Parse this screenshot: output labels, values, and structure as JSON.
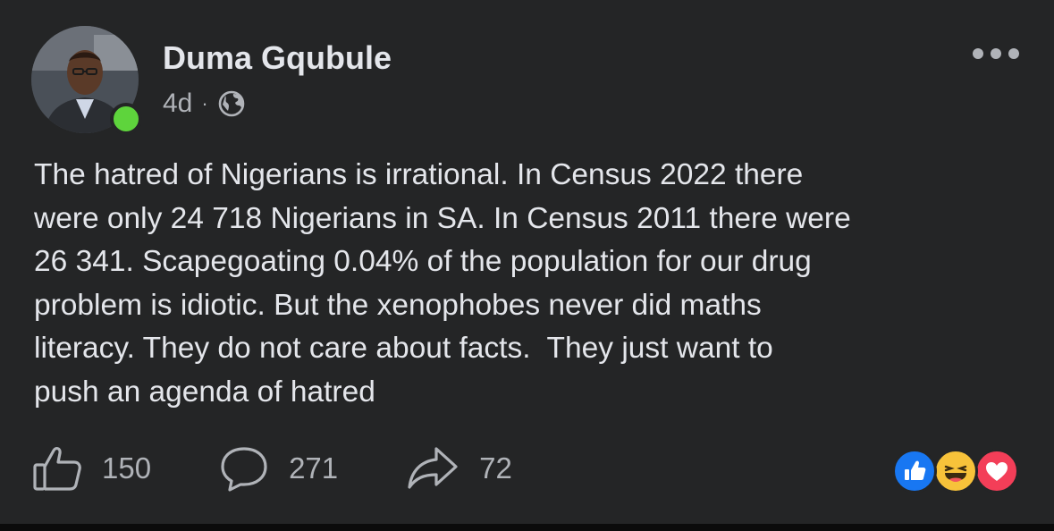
{
  "post": {
    "author": "Duma Gqubule",
    "time": "4d",
    "separator": "·",
    "audience_icon": "globe-icon",
    "text": "The hatred of Nigerians is irrational. In Census 2022 there\nwere only 24 718 Nigerians in SA. In Census 2011 there were\n26 341. Scapegoating 0.04% of the population for our drug\nproblem is idiotic. But the xenophobes never did maths\nliteracy. They do not care about facts.  They just want to\npush an agenda of hatred",
    "online": true
  },
  "actions": {
    "like_count": "150",
    "comment_count": "271",
    "share_count": "72"
  },
  "reactions": [
    "like",
    "haha",
    "love"
  ],
  "colors": {
    "card_bg": "#242526",
    "primary_text": "#e4e6eb",
    "secondary_text": "#b0b3b8",
    "online": "#5ed43c",
    "like_blue": "#1877f2",
    "haha_yellow": "#f7c23a",
    "love_red": "#f33e58"
  }
}
